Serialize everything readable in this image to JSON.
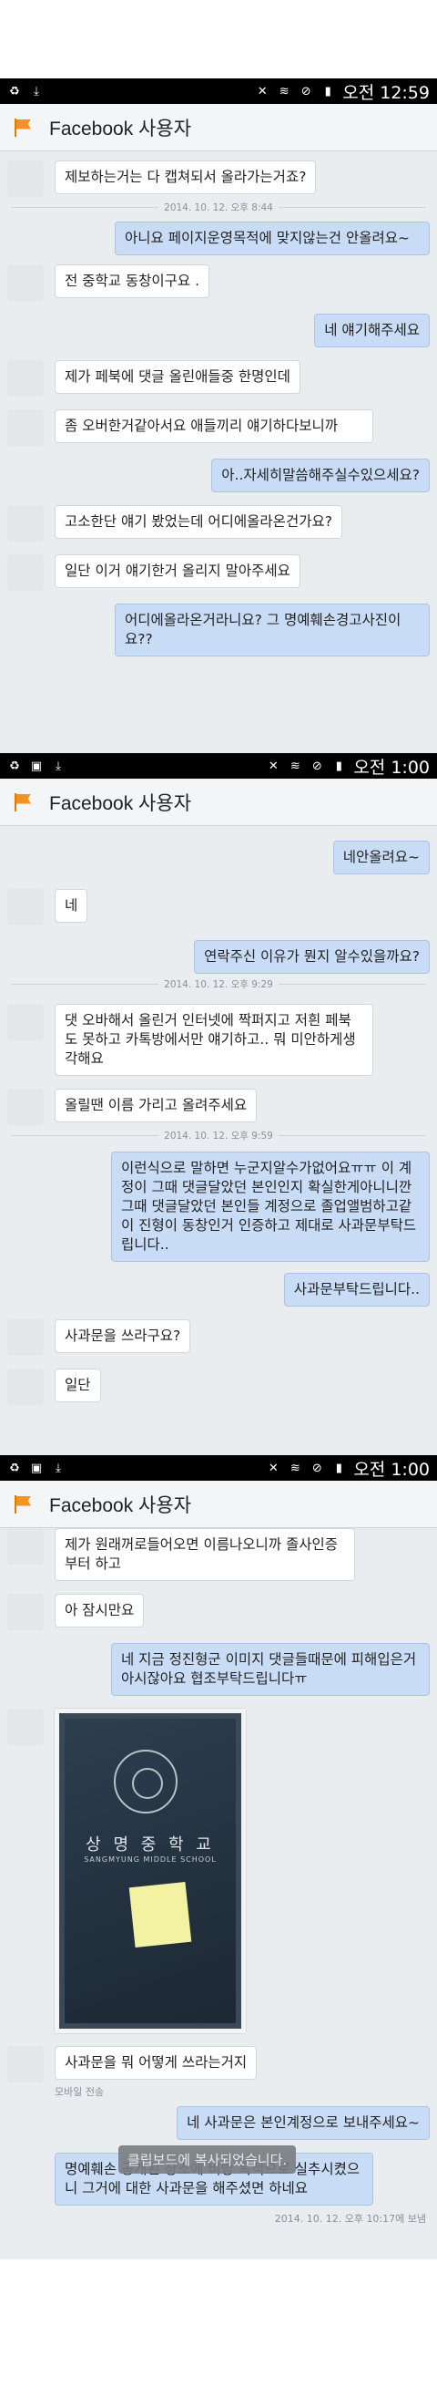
{
  "status_times": [
    "오전 12:59",
    "오전 1:00",
    "오전 1:00"
  ],
  "app_title": "Facebook 사용자",
  "section1": {
    "messages": [
      {
        "dir": "in",
        "text": "제보하는거는 다 캡쳐되서 올라가는거죠?"
      },
      {
        "dir": "ts",
        "text": "2014. 10. 12. 오후 8:44"
      },
      {
        "dir": "out",
        "text": "아니요 페이지운영목적에 맞지않는건 안올려요~"
      },
      {
        "dir": "in",
        "text": "전 중학교 동창이구요 ."
      },
      {
        "dir": "out",
        "text": "네 얘기해주세요"
      },
      {
        "dir": "in",
        "text": "제가 페북에 댓글 올린애들중 한명인데"
      },
      {
        "dir": "in",
        "text": "좀 오버한거같아서요 애들끼리 얘기하다보니까"
      },
      {
        "dir": "out",
        "text": "아..자세히말씀해주실수있으세요?"
      },
      {
        "dir": "in",
        "text": "고소한단 얘기 봤었는데 어디에올라온건가요?"
      },
      {
        "dir": "in",
        "text": "일단 이거 얘기한거 올리지 말아주세요"
      },
      {
        "dir": "out",
        "text": "어디에올라온거라니요? 그 명예훼손경고사진이요??"
      }
    ]
  },
  "section2": {
    "messages": [
      {
        "dir": "out",
        "text": "네안올려요~"
      },
      {
        "dir": "in",
        "text": "네"
      },
      {
        "dir": "out",
        "text": "연락주신 이유가 뭔지 알수있을까요?"
      },
      {
        "dir": "ts",
        "text": "2014. 10. 12. 오후 9:29"
      },
      {
        "dir": "in",
        "text": "댓 오바해서 올린거 인터넷에 짝퍼지고 저흰 페북도 못하고 카톡방에서만 얘기하고..  뭐 미안하게생각해요"
      },
      {
        "dir": "in",
        "text": "올릴땐 이름 가리고 올려주세요"
      },
      {
        "dir": "ts",
        "text": "2014. 10. 12. 오후 9:59"
      },
      {
        "dir": "out",
        "text": "이런식으로 말하면 누군지알수가없어요ㅠㅠ 이 계정이 그때 댓글달았던 본인인지 확실한게아니니깐 그때 댓글달았던 본인들 계정으로 졸업앨범하고같이 진형이 동창인거 인증하고 제대로 사과문부탁드립니다.."
      },
      {
        "dir": "out",
        "text": "사과문부탁드립니다.."
      },
      {
        "dir": "in",
        "text": "사과문을 쓰라구요?"
      },
      {
        "dir": "in",
        "text": "일단"
      }
    ]
  },
  "section3": {
    "messages": [
      {
        "dir": "in",
        "text": "제가 원래꺼로들어오면 이름나오니까 졸사인증부터 하고"
      },
      {
        "dir": "in",
        "text": "아 잠시만요"
      },
      {
        "dir": "out",
        "text": "네 지금 정진형군 이미지 댓글들때문에 피해입은거 아시잖아요 협조부탁드립니다ㅠ"
      }
    ],
    "photo": {
      "school_name": "상 명 중 학 교",
      "school_en": "SANGMYUNG MIDDLE SCHOOL"
    },
    "after_photo": [
      {
        "dir": "in",
        "text": "사과문을 뭐 어떻게 쓰라는거지"
      }
    ],
    "mobile_label": "모바일 전송",
    "out_last": "네 사과문은 본인계정으로 보내주세요~",
    "last_in": "명예훼손 공개된 장소에 비방 목적으로 실추시켰으니 그거에 대한 사과문을 해주셨면 하네요",
    "toast": "클립보드에 복사되었습니다.",
    "footer_ts": "2014. 10. 12. 오후 10:17에 보냄"
  }
}
